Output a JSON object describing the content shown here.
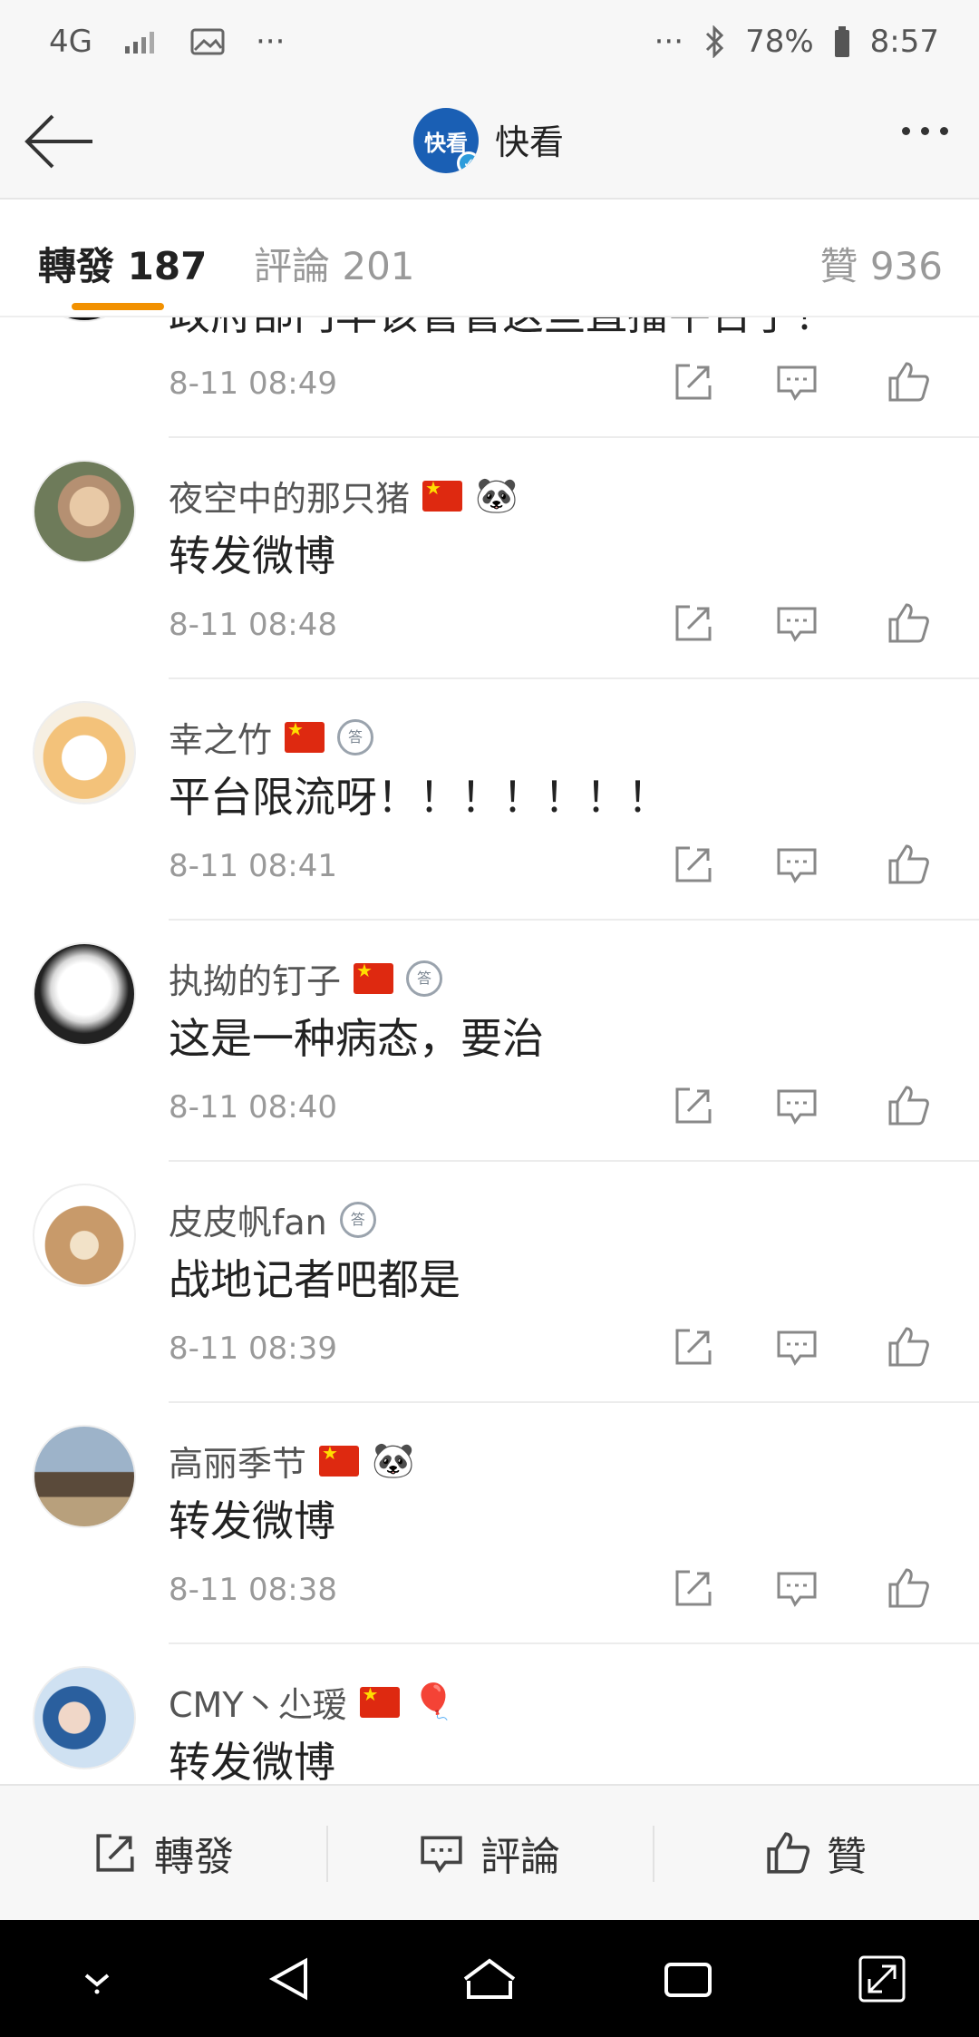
{
  "status_bar": {
    "network": "4G",
    "signal_dots": "···",
    "battery": "78%",
    "time": "8:57"
  },
  "header": {
    "logo_text": "快看",
    "title": "快看"
  },
  "tabs": {
    "reposts": "轉發 187",
    "comments": "評論 201",
    "likes": "贊 936"
  },
  "comments": [
    {
      "name": "",
      "content": "政府部门早该管管这些直播平台了！",
      "time": "8-11 08:49"
    },
    {
      "name": "夜空中的那只猪",
      "content": "转发微博",
      "time": "8-11 08:48"
    },
    {
      "name": "幸之竹",
      "content": "平台限流呀！！！！！！！",
      "time": "8-11 08:41"
    },
    {
      "name": "执拗的钉子",
      "content": "这是一种病态，要治",
      "time": "8-11 08:40"
    },
    {
      "name": "皮皮帆fan",
      "content": "战地记者吧都是",
      "time": "8-11 08:39"
    },
    {
      "name": "高丽季节",
      "content": "转发微博",
      "time": "8-11 08:38"
    },
    {
      "name": "CMY丶尐瑷",
      "content": "转发微博",
      "time": ""
    }
  ],
  "bottom_bar": {
    "repost": "轉發",
    "comment": "評論",
    "like": "贊"
  },
  "colors": {
    "accent": "#f29100",
    "background": "#f7f7f7"
  }
}
